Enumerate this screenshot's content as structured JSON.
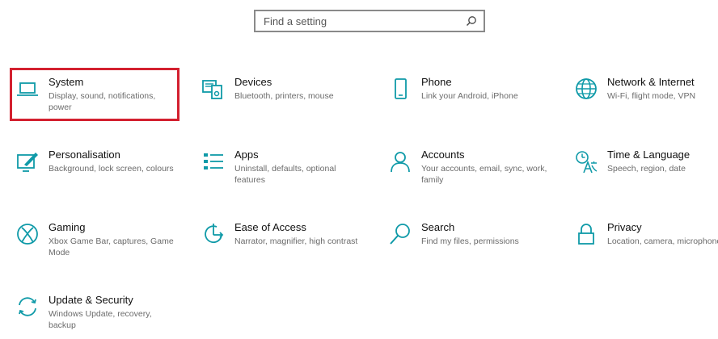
{
  "search": {
    "placeholder": "Find a setting"
  },
  "accent_color": "#0f9aa8",
  "selection_color": "#d3202f",
  "tiles": [
    {
      "title": "System",
      "desc": "Display, sound, notifications, power",
      "icon": "laptop-icon",
      "selected": true
    },
    {
      "title": "Devices",
      "desc": "Bluetooth, printers, mouse",
      "icon": "devices-icon"
    },
    {
      "title": "Phone",
      "desc": "Link your Android, iPhone",
      "icon": "phone-icon"
    },
    {
      "title": "Network & Internet",
      "desc": "Wi-Fi, flight mode, VPN",
      "icon": "globe-icon"
    },
    {
      "title": "Personalisation",
      "desc": "Background, lock screen, colours",
      "icon": "paint-icon"
    },
    {
      "title": "Apps",
      "desc": "Uninstall, defaults, optional features",
      "icon": "apps-list-icon"
    },
    {
      "title": "Accounts",
      "desc": "Your accounts, email, sync, work, family",
      "icon": "person-icon"
    },
    {
      "title": "Time & Language",
      "desc": "Speech, region, date",
      "icon": "time-language-icon"
    },
    {
      "title": "Gaming",
      "desc": "Xbox Game Bar, captures, Game Mode",
      "icon": "xbox-icon"
    },
    {
      "title": "Ease of Access",
      "desc": "Narrator, magnifier, high contrast",
      "icon": "ease-of-access-icon"
    },
    {
      "title": "Search",
      "desc": "Find my files, permissions",
      "icon": "search-icon"
    },
    {
      "title": "Privacy",
      "desc": "Location, camera, microphone",
      "icon": "lock-icon"
    },
    {
      "title": "Update & Security",
      "desc": "Windows Update, recovery, backup",
      "icon": "sync-icon"
    }
  ]
}
